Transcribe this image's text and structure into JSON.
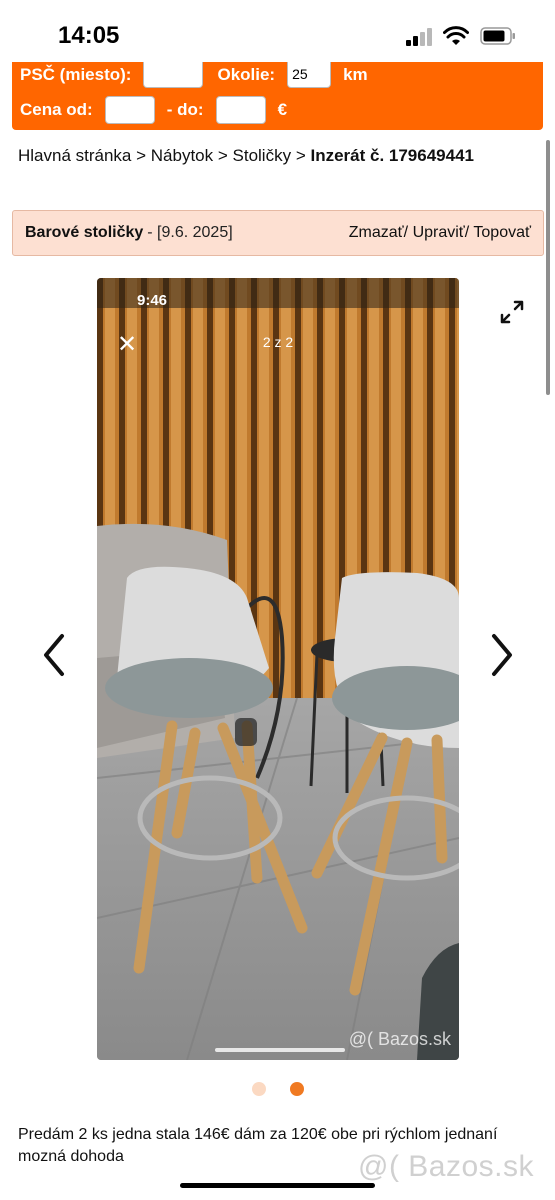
{
  "status": {
    "time": "14:05"
  },
  "search": {
    "psc_label": "PSČ  (miesto):",
    "psc_value": "",
    "okolie_label": "Okolie:",
    "okolie_value": "25",
    "km_label": "km",
    "cena_label": "Cena  od:",
    "cena_from": "",
    "dash_label": "-  do:",
    "cena_to": "",
    "currency": "€"
  },
  "breadcrumb": {
    "home": "Hlavná stránka",
    "sep": " > ",
    "category": "Nábytok",
    "subcategory": "Stoličky",
    "current": "Inzerát č. 179649441"
  },
  "ad": {
    "title": "Barové stoličky",
    "date": "- [9.6. 2025]",
    "actions": "Zmazať/ Upraviť/ Topovať"
  },
  "photo": {
    "inner_time": "9:46",
    "counter": "2 z 2",
    "watermark": "@( Bazos.sk"
  },
  "gallery": {
    "total": 2,
    "active_index": 2
  },
  "description": "Predám 2 ks jedna stala 146€ dám za 120€ obe pri rýchlom jednaní mozná dohoda",
  "footer_watermark": "@( Bazos.sk",
  "colors": {
    "accent": "#ff6600",
    "title_bg": "#fde0d2",
    "dot_active": "#f07a22",
    "dot_inactive": "#fbd9c2"
  },
  "icons": {
    "close": "close-icon",
    "expand": "expand-icon",
    "prev": "chevron-left-icon",
    "next": "chevron-right-icon"
  }
}
